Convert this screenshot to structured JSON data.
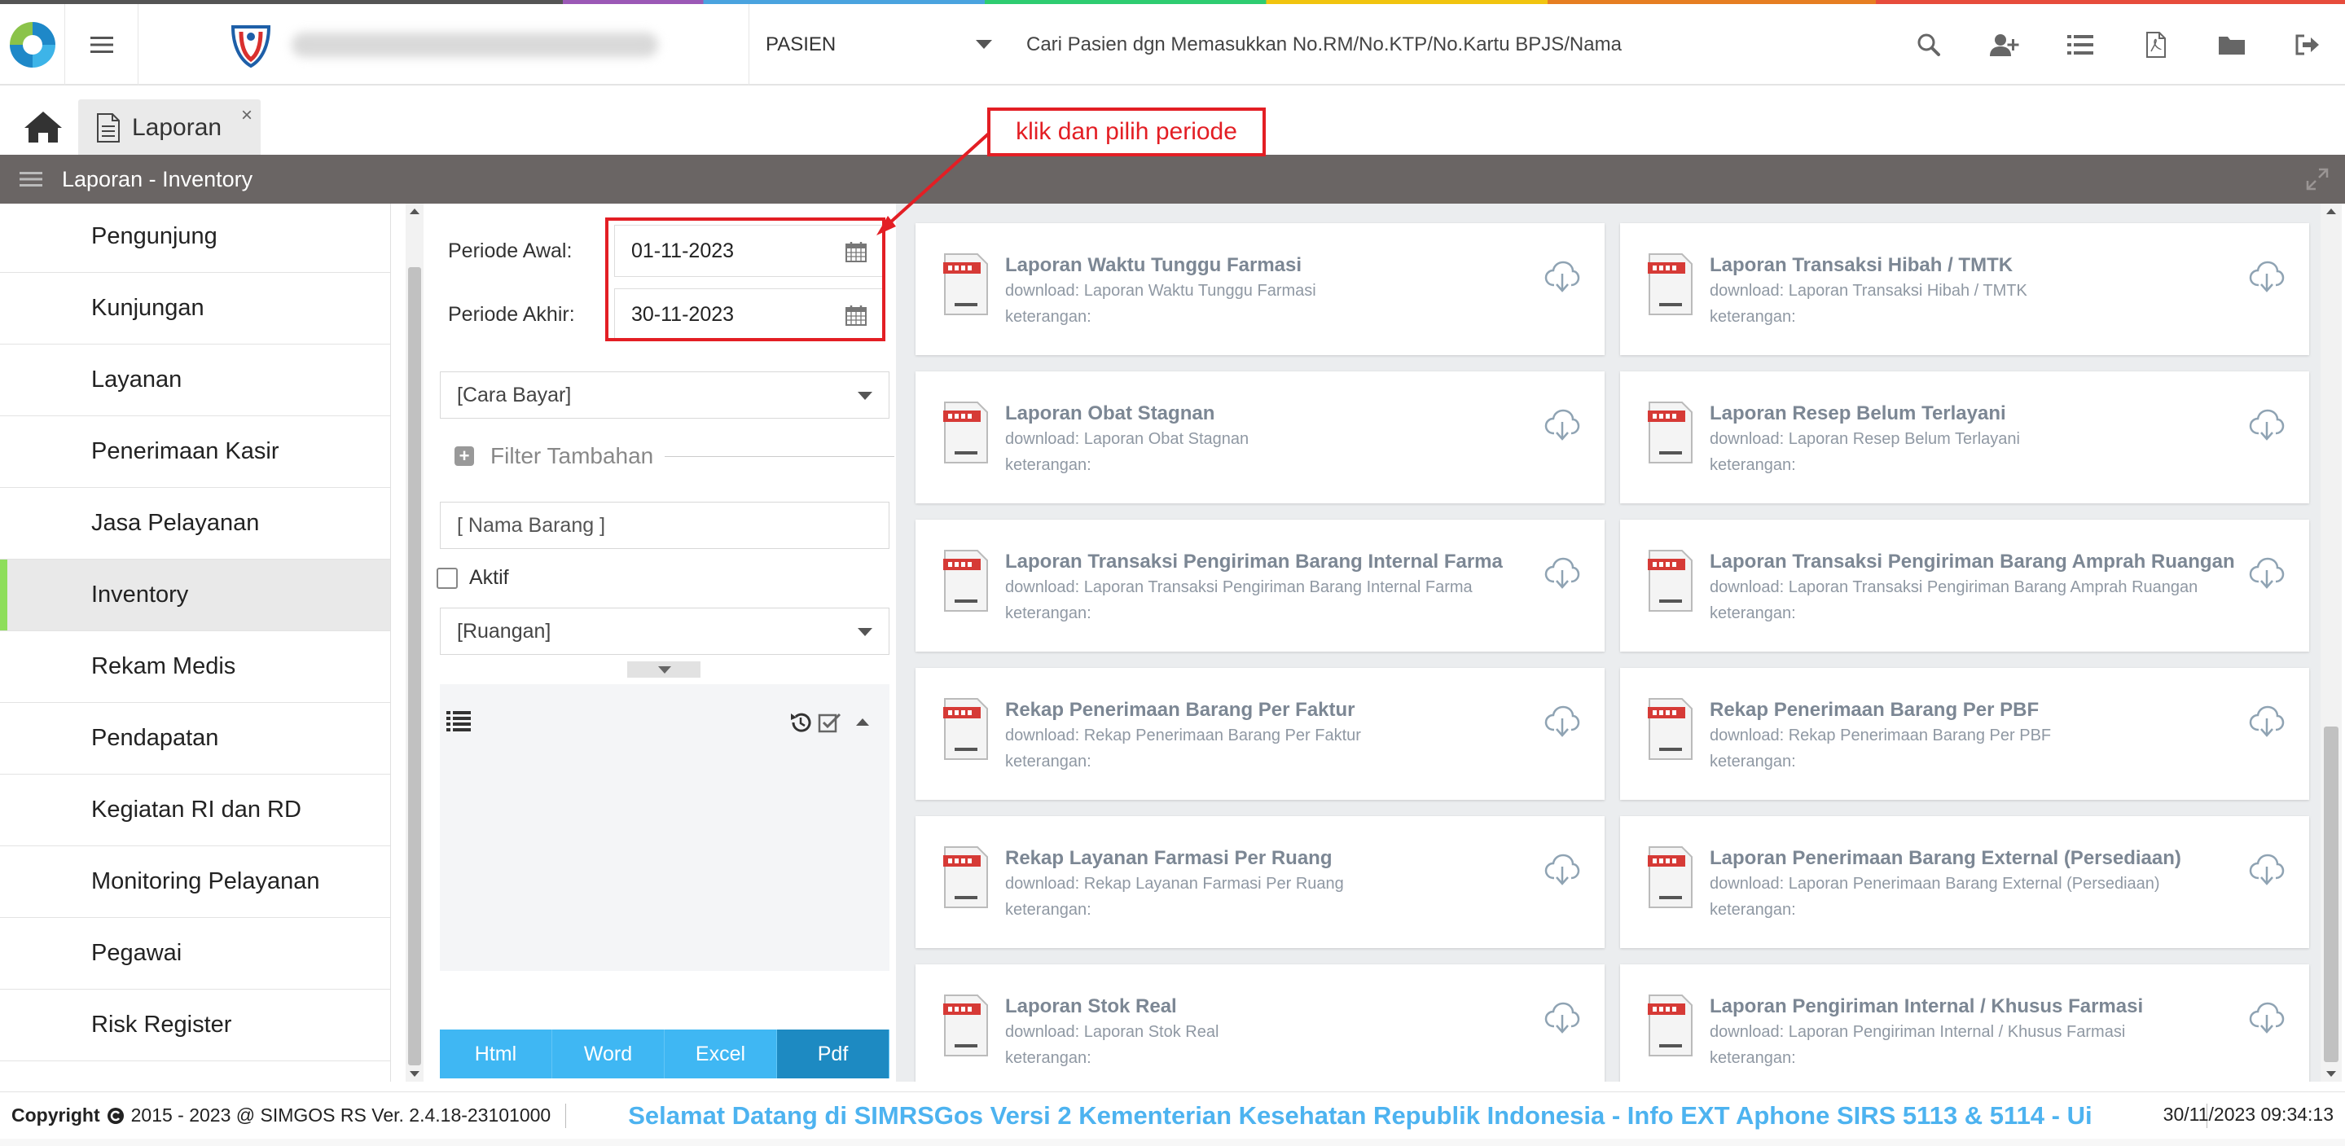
{
  "header": {
    "patient_select": "PASIEN",
    "search_placeholder": "Cari Pasien dgn Memasukkan No.RM/No.KTP/No.Kartu BPJS/Nama"
  },
  "tabs": [
    {
      "label": "Laporan",
      "close": "×"
    }
  ],
  "titlebar": {
    "title": "Laporan - Inventory"
  },
  "sidebar": {
    "items": [
      {
        "label": "Pengunjung"
      },
      {
        "label": "Kunjungan"
      },
      {
        "label": "Layanan"
      },
      {
        "label": "Penerimaan Kasir"
      },
      {
        "label": "Jasa Pelayanan"
      },
      {
        "label": "Inventory",
        "active": true
      },
      {
        "label": "Rekam Medis"
      },
      {
        "label": "Pendapatan"
      },
      {
        "label": "Kegiatan RI dan RD"
      },
      {
        "label": "Monitoring Pelayanan"
      },
      {
        "label": "Pegawai"
      },
      {
        "label": "Risk Register"
      }
    ]
  },
  "filter": {
    "periode_awal_label": "Periode Awal:",
    "periode_awal_value": "01-11-2023",
    "periode_akhir_label": "Periode Akhir:",
    "periode_akhir_value": "30-11-2023",
    "cara_bayar": "[Cara Bayar]",
    "filter_tambahan": "Filter Tambahan",
    "nama_barang": "[ Nama Barang ]",
    "aktif_label": "Aktif",
    "ruangan": "[Ruangan]",
    "export": {
      "html": "Html",
      "word": "Word",
      "excel": "Excel",
      "pdf": "Pdf"
    }
  },
  "reports": [
    {
      "title": "Laporan Waktu Tunggu Farmasi",
      "download": "download: Laporan Waktu Tunggu Farmasi",
      "keterangan": "keterangan:"
    },
    {
      "title": "Laporan Transaksi Hibah / TMTK",
      "download": "download: Laporan Transaksi Hibah / TMTK",
      "keterangan": "keterangan:"
    },
    {
      "title": "Laporan Obat Stagnan",
      "download": "download: Laporan Obat Stagnan",
      "keterangan": "keterangan:"
    },
    {
      "title": "Laporan Resep Belum Terlayani",
      "download": "download: Laporan Resep Belum Terlayani",
      "keterangan": "keterangan:"
    },
    {
      "title": "Laporan Transaksi Pengiriman Barang Internal Farma",
      "download": "download: Laporan Transaksi Pengiriman Barang Internal Farma",
      "keterangan": "keterangan:"
    },
    {
      "title": "Laporan Transaksi Pengiriman Barang Amprah Ruangan",
      "download": "download: Laporan Transaksi Pengiriman Barang Amprah Ruangan",
      "keterangan": "keterangan:"
    },
    {
      "title": "Rekap Penerimaan Barang Per Faktur",
      "download": "download: Rekap Penerimaan Barang Per Faktur",
      "keterangan": "keterangan:"
    },
    {
      "title": "Rekap Penerimaan Barang Per PBF",
      "download": "download: Rekap Penerimaan Barang Per PBF",
      "keterangan": "keterangan:"
    },
    {
      "title": "Rekap Layanan Farmasi Per Ruang",
      "download": "download: Rekap Layanan Farmasi Per Ruang",
      "keterangan": "keterangan:"
    },
    {
      "title": "Laporan Penerimaan Barang External (Persediaan)",
      "download": "download: Laporan Penerimaan Barang External (Persediaan)",
      "keterangan": "keterangan:"
    },
    {
      "title": "Laporan Stok Real",
      "download": "download: Laporan Stok Real",
      "keterangan": "keterangan:"
    },
    {
      "title": "Laporan Pengiriman Internal / Khusus Farmasi",
      "download": "download: Laporan Pengiriman Internal / Khusus Farmasi",
      "keterangan": "keterangan:"
    }
  ],
  "annotation": {
    "text": "klik dan pilih periode"
  },
  "footer": {
    "copyright_label": "Copyright",
    "copyright_text": "2015 - 2023 @ SIMGOS RS Ver. 2.4.18-23101000",
    "marquee": "Selamat Datang di SIMRSGos Versi 2 Kementerian Kesehatan Republik Indonesia - Info EXT Aphone SIRS 5113 & 5114 - Ui",
    "datetime": "30/11/2023 09:34:13"
  },
  "colors": {
    "accent_blue": "#3fb7f3",
    "active_green": "#8ede5a",
    "annotation_red": "#e31e24",
    "titlebar_gray": "#6a6564"
  }
}
